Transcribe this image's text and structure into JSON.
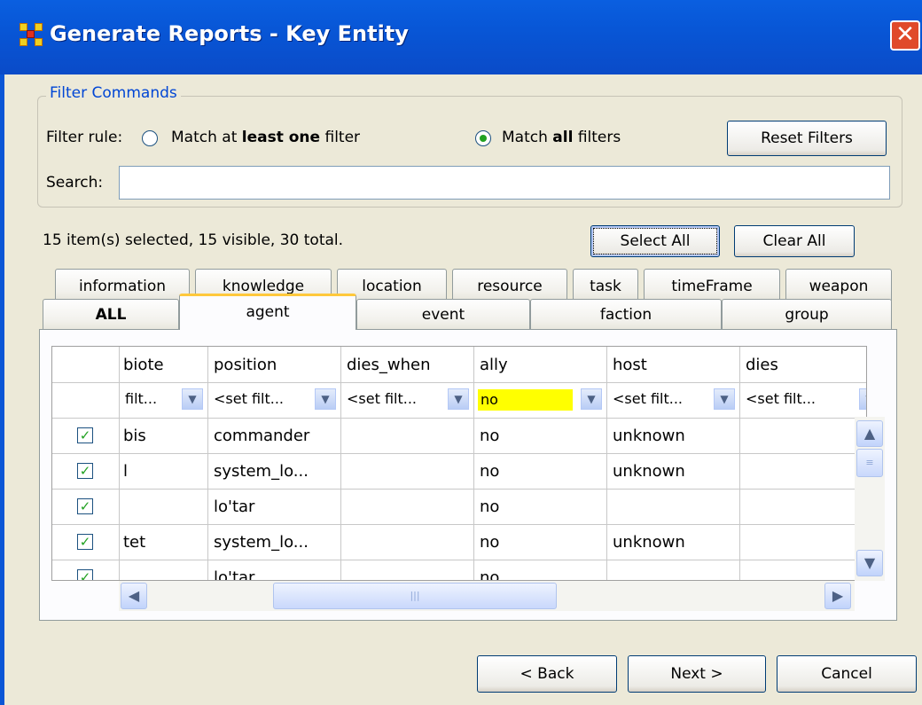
{
  "window": {
    "title": "Generate Reports - Key Entity",
    "close_glyph": "✕"
  },
  "filter": {
    "group_title": "Filter Commands",
    "rule_label": "Filter rule:",
    "option_one_pre": "Match at ",
    "option_one_bold": "least one",
    "option_one_post": " filter",
    "option_all_pre": "Match ",
    "option_all_bold": "all",
    "option_all_post": " filters",
    "selected_option": "all",
    "reset_button": "Reset Filters",
    "search_label": "Search:",
    "search_value": ""
  },
  "status": "15 item(s) selected, 15 visible, 30 total.",
  "buttons": {
    "select_all": "Select All",
    "clear_all": "Clear All",
    "back": "< Back",
    "next": "Next >",
    "cancel": "Cancel"
  },
  "tabs_row1": [
    "information",
    "knowledge",
    "location",
    "resource",
    "task",
    "timeFrame",
    "weapon"
  ],
  "tabs_row2": [
    "ALL",
    "agent",
    "event",
    "faction",
    "group"
  ],
  "active_tab": "agent",
  "table": {
    "columns": [
      "biote",
      "position",
      "dies_when",
      "ally",
      "host",
      "dies"
    ],
    "filters": [
      "filt...",
      "<set filt...",
      "<set filt...",
      "no",
      "<set filt...",
      "<set filt..."
    ],
    "highlight_color": "#ffff00",
    "rows": [
      {
        "checked": true,
        "cells": [
          "bis",
          "commander",
          "",
          "no",
          "unknown",
          ""
        ]
      },
      {
        "checked": true,
        "cells": [
          "l",
          "system_lo...",
          "",
          "no",
          "unknown",
          ""
        ]
      },
      {
        "checked": true,
        "cells": [
          "",
          "lo'tar",
          "",
          "no",
          "",
          ""
        ]
      },
      {
        "checked": true,
        "cells": [
          "tet",
          "system_lo...",
          "",
          "no",
          "unknown",
          ""
        ]
      },
      {
        "checked": true,
        "cells": [
          "",
          "lo'tar",
          "",
          "no",
          "",
          ""
        ]
      }
    ]
  },
  "icons": {
    "check": "✓",
    "dropdown": "chevron-down-icon",
    "scroll_up": "▲",
    "scroll_down": "▼",
    "scroll_left": "◀",
    "scroll_right": "▶"
  }
}
